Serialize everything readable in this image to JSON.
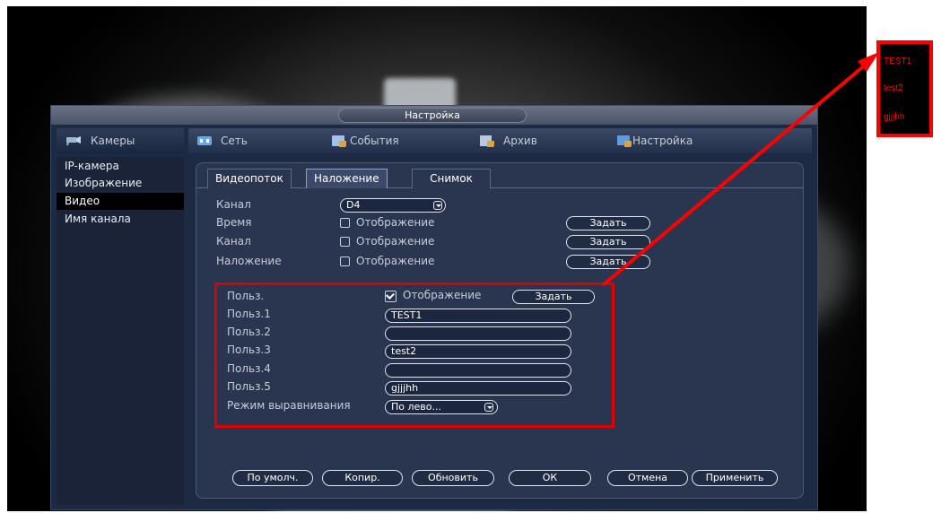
{
  "dialog": {
    "title": "Настройка"
  },
  "top_menu": {
    "cameras": "Камеры",
    "network": "Сеть",
    "events": "События",
    "archive": "Архив",
    "settings": "Настройка"
  },
  "sidebar": {
    "items": [
      {
        "label": "IP-камера"
      },
      {
        "label": "Изображение"
      },
      {
        "label": "Видео",
        "selected": true
      },
      {
        "label": "Имя канала"
      }
    ]
  },
  "tabs": [
    {
      "label": "Видеопоток"
    },
    {
      "label": "Наложение",
      "active": true
    },
    {
      "label": "Снимок"
    }
  ],
  "form": {
    "channel_label": "Канал",
    "channel_value": "D4",
    "time_label": "Время",
    "time_check": "Отображение",
    "time_checked": false,
    "time_set": "Задать",
    "channel2_label": "Канал",
    "channel2_check": "Отображение",
    "channel2_checked": false,
    "channel2_set": "Задать",
    "overlay_label": "Наложение",
    "overlay_check": "Отображение",
    "overlay_checked": false,
    "overlay_set": "Задать"
  },
  "user": {
    "label": "Польз.",
    "check": "Отображение",
    "checked": true,
    "set": "Задать",
    "fields": [
      {
        "label": "Польз.1",
        "value": "TEST1"
      },
      {
        "label": "Польз.2",
        "value": ""
      },
      {
        "label": "Польз.3",
        "value": "test2"
      },
      {
        "label": "Польз.4",
        "value": ""
      },
      {
        "label": "Польз.5",
        "value": "gjjjhh"
      }
    ],
    "align_label": "Режим выравнивания",
    "align_value": "По лево..."
  },
  "buttons": {
    "default": "По умолч.",
    "copy": "Копир.",
    "refresh": "Обновить",
    "ok": "ОК",
    "cancel": "Отмена",
    "apply": "Применить"
  },
  "osd_preview": {
    "lines": [
      "TEST1",
      "test2",
      "gjjjhh"
    ]
  },
  "colors": {
    "highlight": "#ff0000",
    "menu_accent": "#4fb8ff",
    "panel": "#2a3550"
  }
}
